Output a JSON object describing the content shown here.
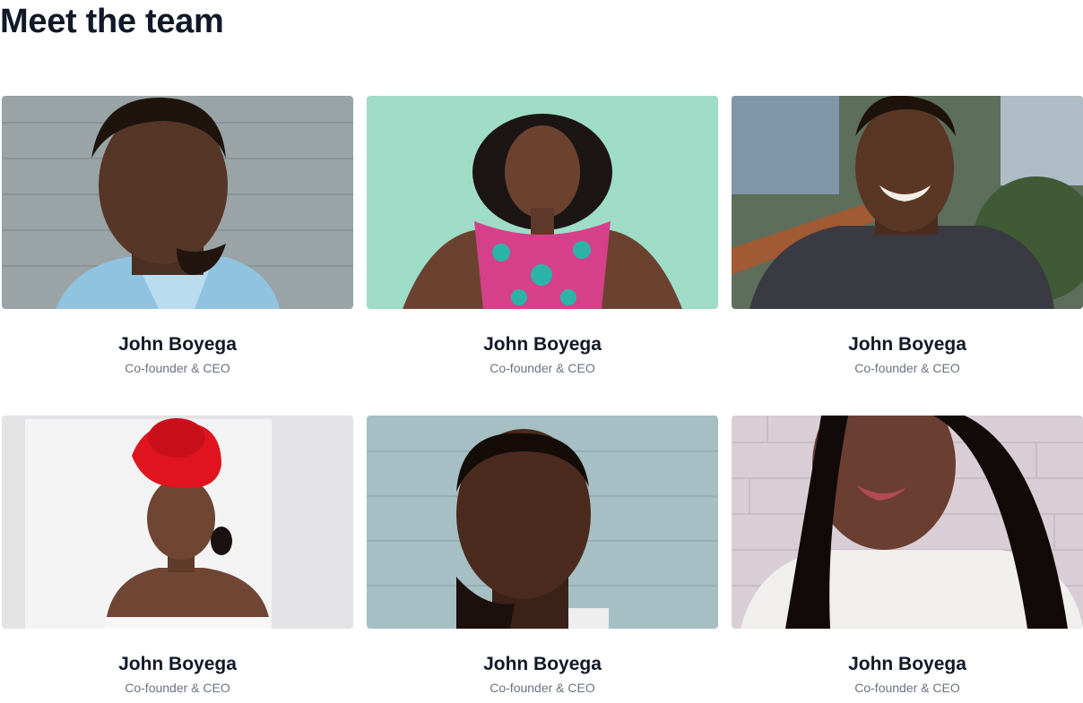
{
  "section": {
    "title": "Meet the team"
  },
  "team": [
    {
      "name": "John Boyega",
      "role": "Co-founder & CEO",
      "photo": "portrait-man-grey-wall"
    },
    {
      "name": "John Boyega",
      "role": "Co-founder & CEO",
      "photo": "portrait-woman-mint-wall"
    },
    {
      "name": "John Boyega",
      "role": "Co-founder & CEO",
      "photo": "portrait-man-smiling-outdoors"
    },
    {
      "name": "John Boyega",
      "role": "Co-founder & CEO",
      "photo": "portrait-woman-red-headwrap"
    },
    {
      "name": "John Boyega",
      "role": "Co-founder & CEO",
      "photo": "portrait-man-blue-wall"
    },
    {
      "name": "John Boyega",
      "role": "Co-founder & CEO",
      "photo": "portrait-woman-brick-wall"
    }
  ],
  "colors": {
    "heading": "#111827",
    "name": "#111827",
    "role": "#6b7280"
  }
}
